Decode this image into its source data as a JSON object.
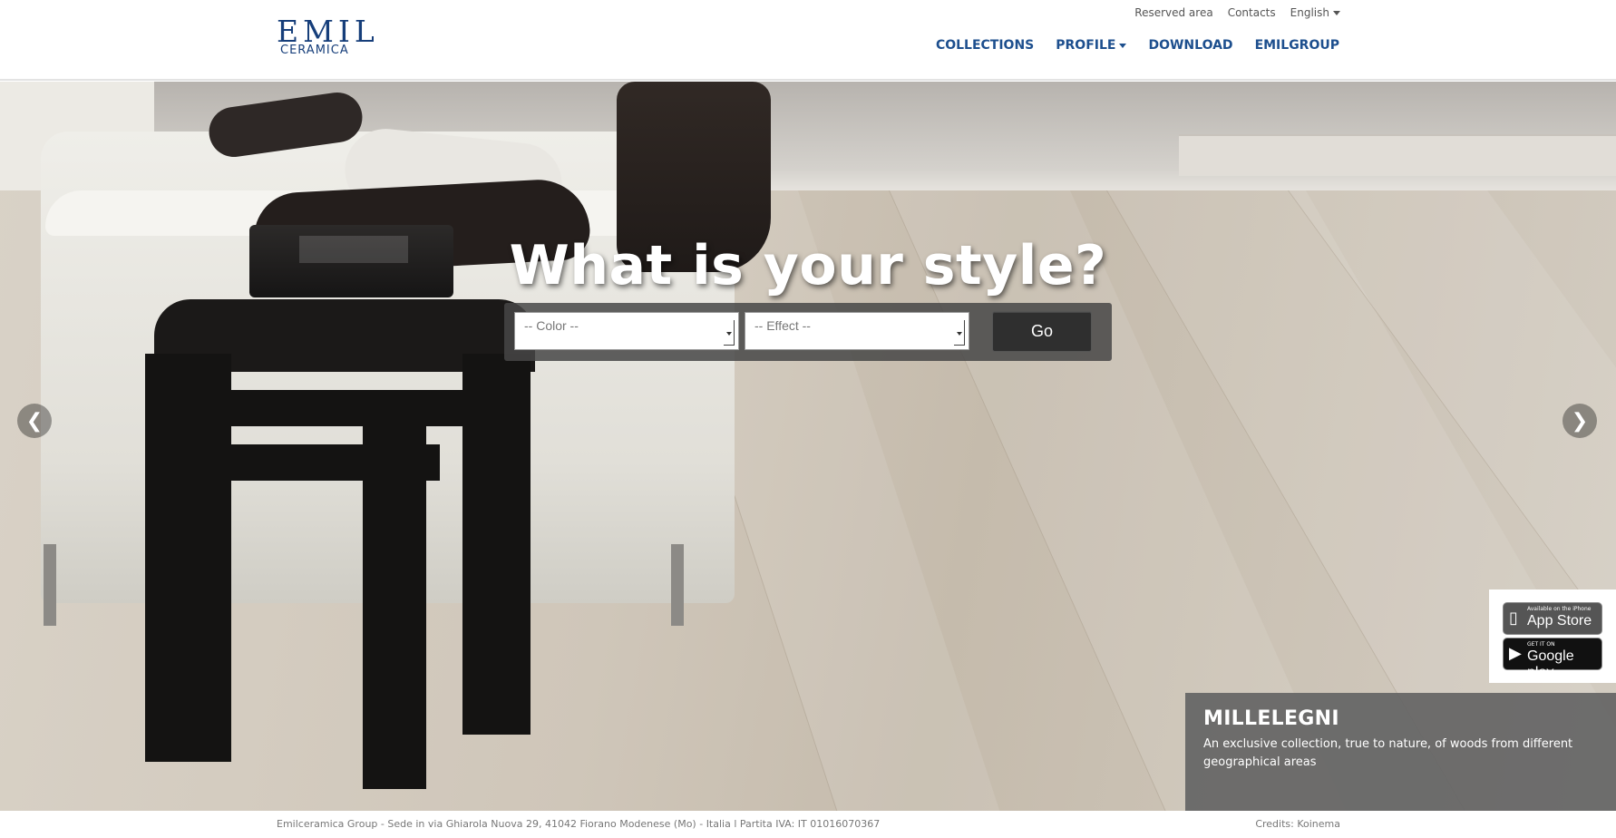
{
  "header": {
    "logo_main": "EMIL",
    "logo_sub": "CERAMICA",
    "top_links": {
      "reserved_area": "Reserved area",
      "contacts": "Contacts",
      "language": "English"
    },
    "nav": {
      "collections": "COLLECTIONS",
      "profile": "PROFILE",
      "download": "DOWNLOAD",
      "emilgroup": "EMILGROUP"
    }
  },
  "hero": {
    "headline": "What is your style?",
    "search": {
      "color_placeholder": "-- Color --",
      "effect_placeholder": "-- Effect --",
      "go_label": "Go"
    },
    "prev_icon": "❮",
    "next_icon": "❯",
    "caption": {
      "title": "MILLELEGNI",
      "text": "An exclusive collection, true to nature, of woods from different geographical areas"
    }
  },
  "apps": {
    "appstore_small": "Available on the iPhone",
    "appstore_big": "App Store",
    "googleplay_small": "GET IT ON",
    "googleplay_big": "Google play"
  },
  "footer": {
    "left": "Emilceramica Group - Sede in via Ghiarola Nuova 29, 41042 Fiorano Modenese (Mo) - Italia l Partita IVA: IT 01016070367",
    "right": "Credits: Koinema"
  },
  "colors": {
    "brand_blue": "#163e7a",
    "nav_blue": "#1d4f8e",
    "caption_bg": "#646464"
  }
}
